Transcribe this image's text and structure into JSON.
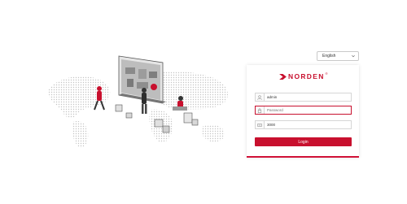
{
  "language": {
    "selected": "English"
  },
  "brand": {
    "logo_text": "NORDEN",
    "mark": "®"
  },
  "form": {
    "username_value": "admin",
    "password_placeholder": "Password",
    "captcha_value": "3000",
    "login_label": "Login"
  },
  "colors": {
    "accent": "#c8102e"
  },
  "icons": {
    "username": "user-icon",
    "password": "lock-icon",
    "captcha": "captcha-icon",
    "dropdown": "chevron-down-icon"
  }
}
